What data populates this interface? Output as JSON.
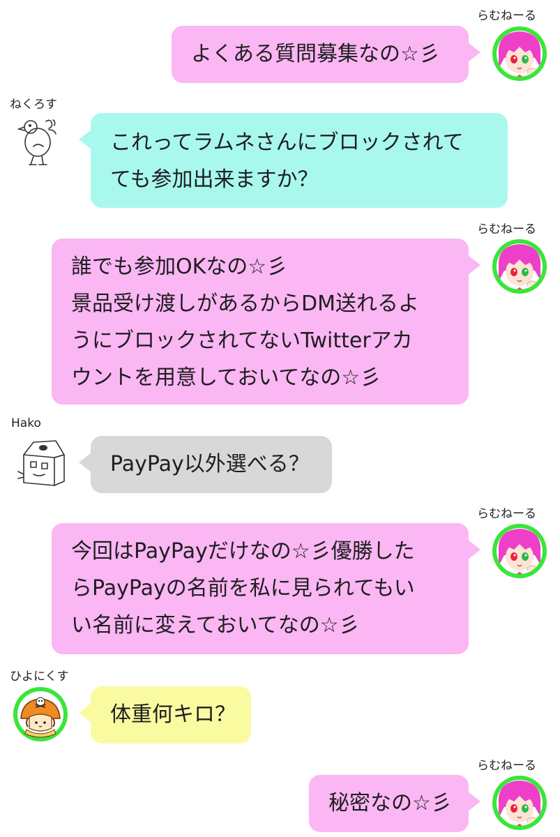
{
  "messages": [
    {
      "sender": "らむねーる",
      "side": "right",
      "lines": [
        "よくある質問募集なの☆彡"
      ]
    },
    {
      "sender": "ねくろす",
      "side": "left",
      "lines": [
        "これってラムネさんにブロックされて",
        "ても参加出来ますか？"
      ]
    },
    {
      "sender": "らむねーる",
      "side": "right",
      "lines": [
        "誰でも参加OKなの☆彡",
        "景品受け渡しがあるからDM送れるよ",
        "うにブロックされてないTwitterアカ",
        "ウントを用意しておいてなの☆彡"
      ]
    },
    {
      "sender": "Hako",
      "side": "left",
      "lines": [
        "PayPay以外選べる？"
      ]
    },
    {
      "sender": "らむねーる",
      "side": "right",
      "lines": [
        "今回はPayPayだけなの☆彡優勝した",
        "らPayPayの名前を私に見られてもい",
        "い名前に変えておいてなの☆彡"
      ]
    },
    {
      "sender": "ひよにくす",
      "side": "left",
      "lines": [
        "体重何キロ？"
      ]
    },
    {
      "sender": "らむねーる",
      "side": "right",
      "lines": [
        "秘密なの☆彡"
      ]
    }
  ],
  "avatar_icons": [
    "ramune-avatar-icon",
    "chick-drawing-icon",
    "house-drawing-icon",
    "mushroom-character-icon"
  ],
  "colors": {
    "ramune_bubble": "#fbb6f4",
    "nekurosu_bubble": "#a8f8ee",
    "hako_bubble": "#d8d8d8",
    "hiyonikusu_bubble": "#fafaa0",
    "avatar_ring": "#39e639"
  }
}
